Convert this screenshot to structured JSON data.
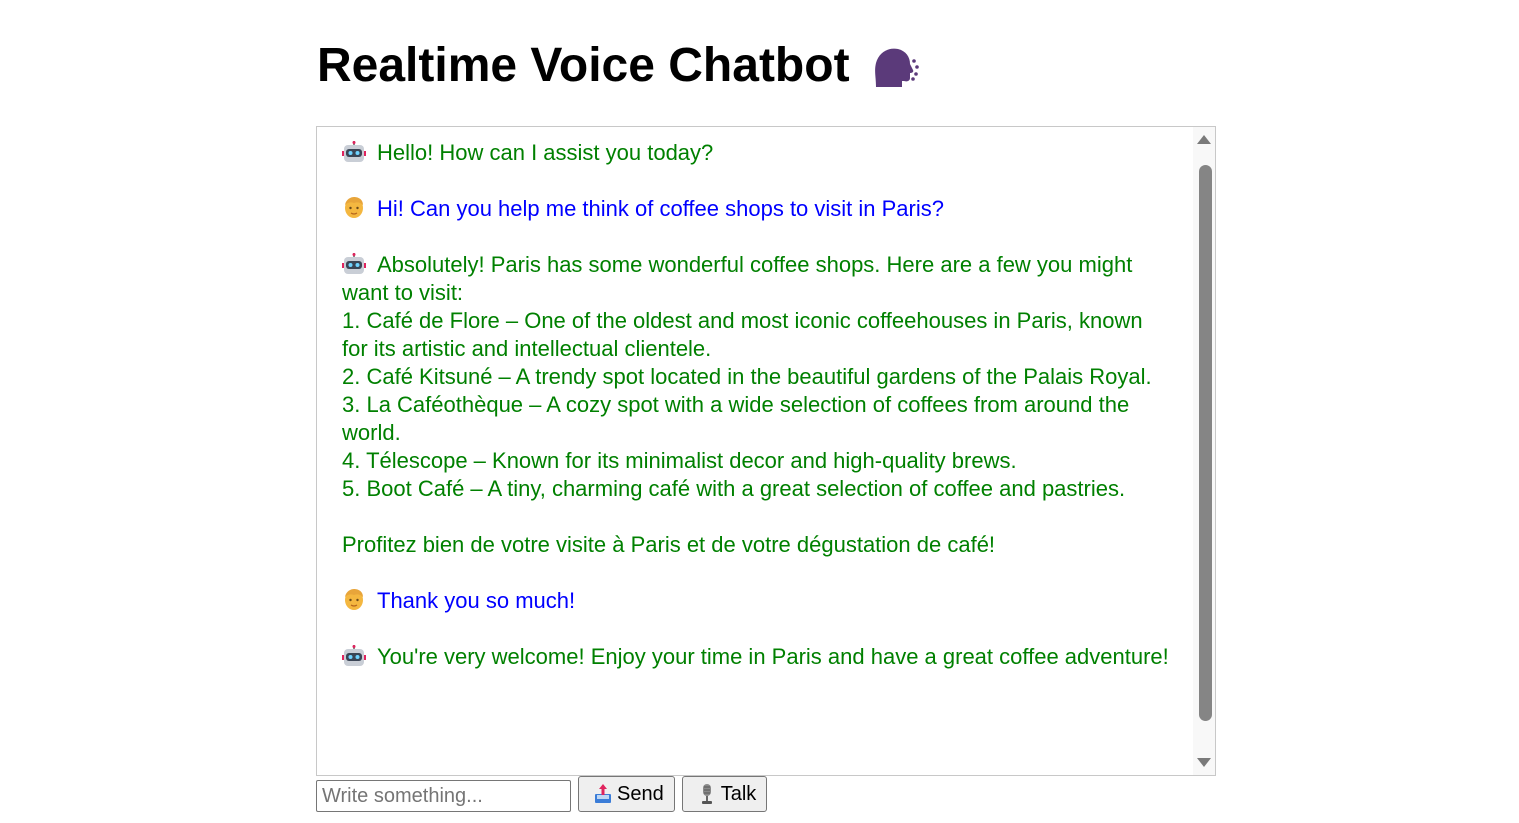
{
  "header": {
    "title": "Realtime Voice Chatbot",
    "title_icon": "speaking-head-icon"
  },
  "chat": {
    "messages": [
      {
        "role": "bot",
        "avatar": "robot-icon",
        "text": "Hello! How can I assist you today?"
      },
      {
        "role": "user",
        "avatar": "person-icon",
        "text": "Hi! Can you help me think of coffee shops to visit in Paris?"
      },
      {
        "role": "bot",
        "avatar": "robot-icon",
        "text": "Absolutely! Paris has some wonderful coffee shops. Here are a few you might want to visit:\n1. Café de Flore – One of the oldest and most iconic coffeehouses in Paris, known for its artistic and intellectual clientele.\n2. Café Kitsuné – A trendy spot located in the beautiful gardens of the Palais Royal.\n3. La Caféothèque – A cozy spot with a wide selection of coffees from around the world.\n4. Télescope – Known for its minimalist decor and high-quality brews.\n5. Boot Café – A tiny, charming café with a great selection of coffee and pastries.\n\nProfitez bien de votre visite à Paris et de votre dégustation de café!"
      },
      {
        "role": "user",
        "avatar": "person-icon",
        "text": "Thank you so much!"
      },
      {
        "role": "bot",
        "avatar": "robot-icon",
        "text": "You're very welcome! Enjoy your time in Paris and have a great coffee adventure!"
      }
    ],
    "colors": {
      "bot": "#008000",
      "user": "#0000ff"
    }
  },
  "composer": {
    "input_value": "",
    "input_placeholder": "Write something...",
    "send_label": "Send",
    "send_icon": "outbox-tray-icon",
    "talk_label": "Talk",
    "talk_icon": "microphone-icon"
  }
}
